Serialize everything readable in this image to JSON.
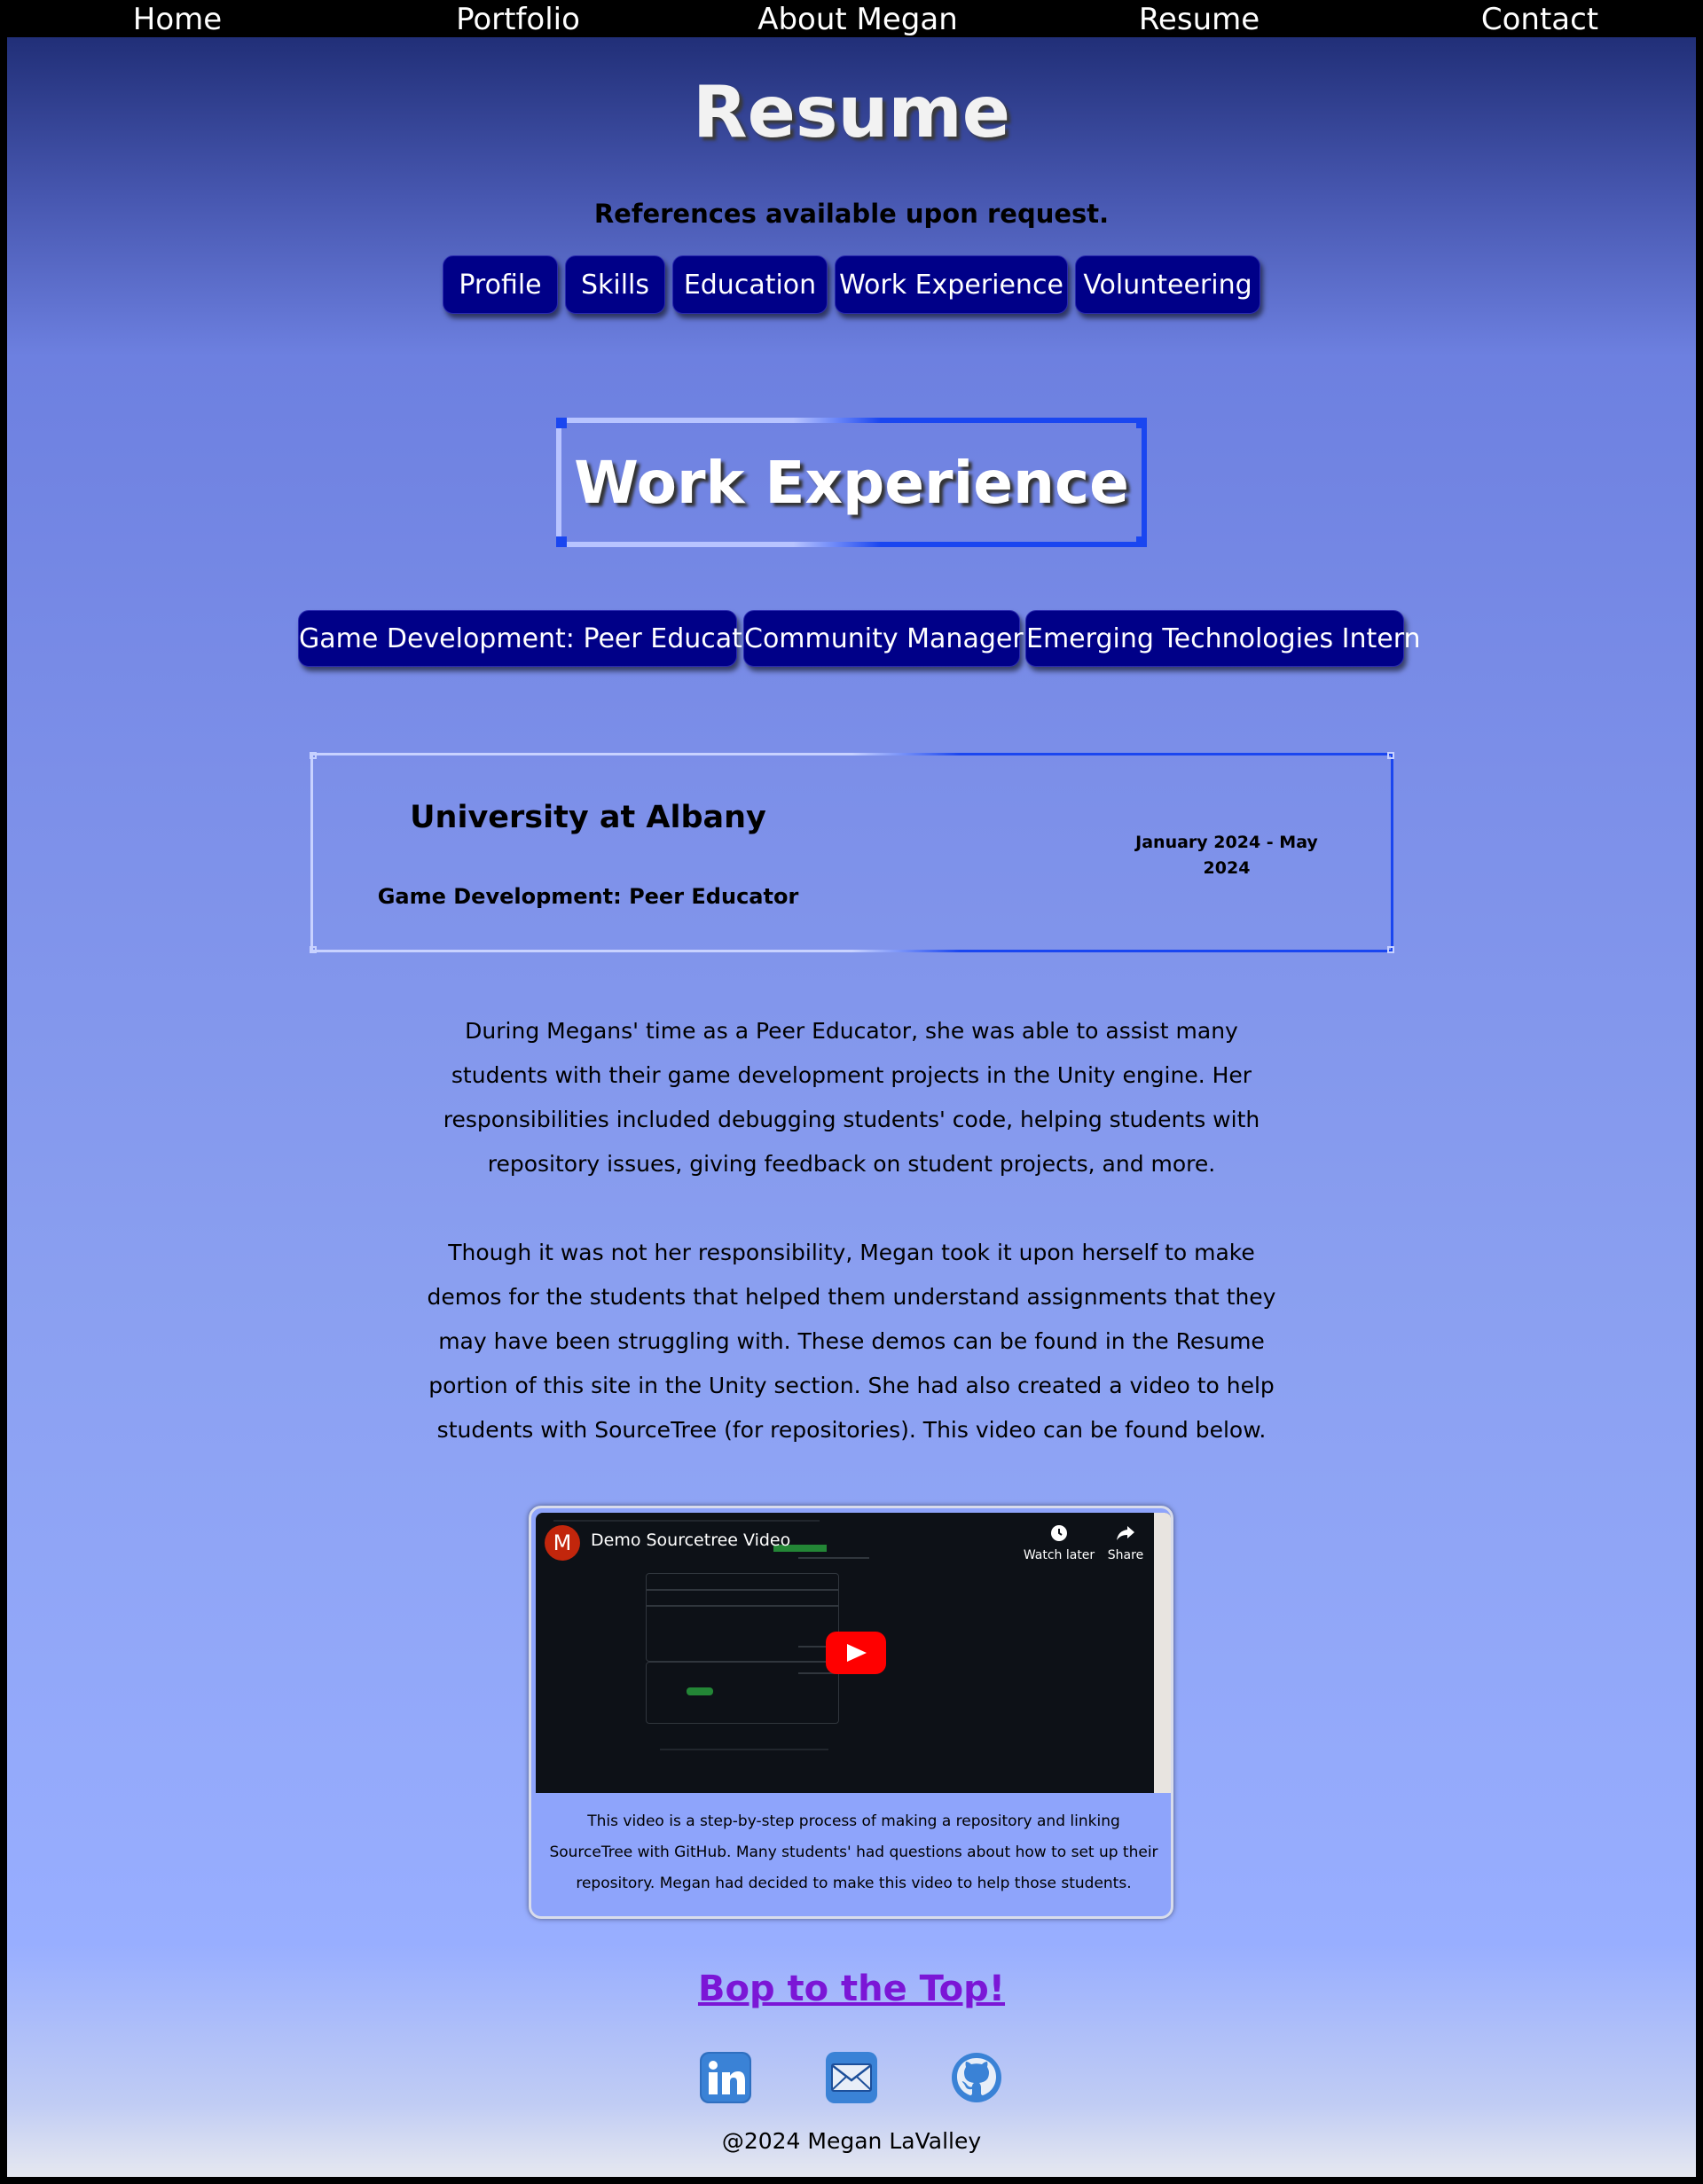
{
  "nav": {
    "items": [
      {
        "label": "Home"
      },
      {
        "label": "Portfolio"
      },
      {
        "label": "About Megan"
      },
      {
        "label": "Resume"
      },
      {
        "label": "Contact"
      }
    ]
  },
  "header": {
    "title": "Resume",
    "subtitle": "References available upon request."
  },
  "section_tabs": [
    {
      "label": "Profile"
    },
    {
      "label": "Skills"
    },
    {
      "label": "Education"
    },
    {
      "label": "Work Experience"
    },
    {
      "label": "Volunteering"
    }
  ],
  "section": {
    "title": "Work Experience"
  },
  "job_tabs": [
    {
      "label": "Game Development: Peer Educator"
    },
    {
      "label": "Community Manager"
    },
    {
      "label": "Emerging Technologies Intern"
    }
  ],
  "job": {
    "employer": "University at Albany",
    "role": "Game Development: Peer Educator",
    "dates": "January 2024 - May 2024",
    "paragraphs": [
      "During Megans' time as a Peer Educator, she was able to assist many students with their game development projects in the Unity engine. Her responsibilities included debugging students' code, helping students with repository issues, giving feedback on student projects, and more.",
      "Though it was not her responsibility, Megan took it upon herself to make demos for the students that helped them understand assignments that they may have been struggling with. These demos can be found in the Resume portion of this site in the Unity section. She had also created a video to help students with SourceTree (for repositories). This video can be found below."
    ]
  },
  "video": {
    "channel_initial": "M",
    "title": "Demo Sourcetree Video",
    "watch_later": "Watch later",
    "share": "Share",
    "caption": "This video is a step-by-step process of making a repository and linking SourceTree with GitHub. Many students' had questions about how to set up their repository. Megan had decided to make this video to help those students."
  },
  "footer": {
    "top_link": "Bop to the Top!",
    "social_icons": [
      "linkedin-icon",
      "mail-icon",
      "github-icon"
    ],
    "copyright": "@2024 Megan LaValley"
  },
  "colors": {
    "nav_bg": "#000000",
    "pill_bg": "#000088",
    "accent_blue": "#1a46f0",
    "link_purple": "#7b16d6",
    "youtube_red": "#ff0000"
  }
}
